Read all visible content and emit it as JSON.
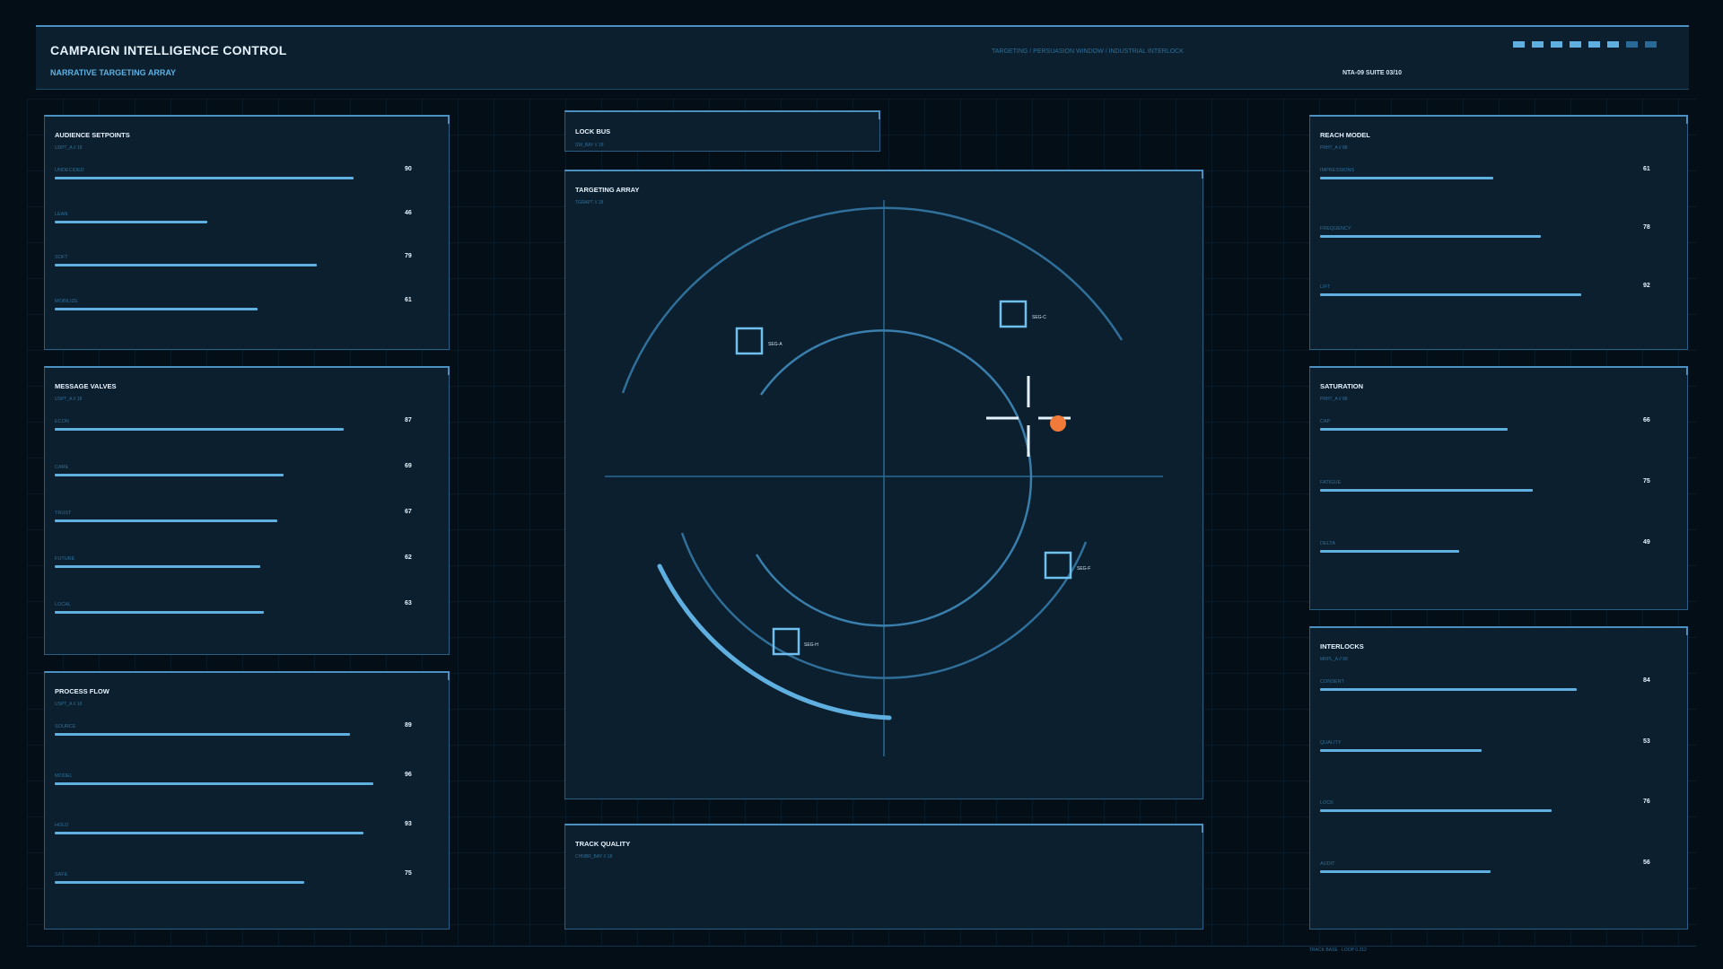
{
  "header": {
    "title": "CAMPAIGN INTELLIGENCE CONTROL",
    "subtitle": "NARRATIVE TARGETING ARRAY",
    "breadcrumb": "TARGETING / PERSUASION WINDOW / INDUSTRIAL INTERLOCK",
    "suite": "NTA-09 SUITE 03/10"
  },
  "left": {
    "audience": {
      "title": "AUDIENCE SETPOINTS",
      "code": "UDPT_A // 18",
      "metrics": [
        {
          "label": "UNDECIDED",
          "value": 90
        },
        {
          "label": "LEAN",
          "value": 46
        },
        {
          "label": "SOFT",
          "value": 79
        },
        {
          "label": "MOBILIZE",
          "value": 61
        }
      ]
    },
    "message": {
      "title": "MESSAGE VALVES",
      "code": "USPT_A // 18",
      "metrics": [
        {
          "label": "ECON",
          "value": 87
        },
        {
          "label": "CARE",
          "value": 69
        },
        {
          "label": "TRUST",
          "value": 67
        },
        {
          "label": "FUTURE",
          "value": 62
        },
        {
          "label": "LOCAL",
          "value": 63
        }
      ]
    },
    "process": {
      "title": "PROCESS FLOW",
      "code": "USPT_A // 18",
      "metrics": [
        {
          "label": "SOURCE",
          "value": 89
        },
        {
          "label": "MODEL",
          "value": 96
        },
        {
          "label": "HOLD",
          "value": 93
        },
        {
          "label": "SAFE",
          "value": 75
        }
      ]
    }
  },
  "center": {
    "lockbus": {
      "title": "LOCK BUS",
      "code": "SW_BAY // 18"
    },
    "targeting": {
      "title": "TARGETING ARRAY",
      "code": "TGRAPT // 18",
      "segments": [
        "SEG-A",
        "SEG-C",
        "SEG-F",
        "SEG-H"
      ]
    },
    "track": {
      "title": "TRACK QUALITY",
      "code": "CHNBR_BAY // 18"
    }
  },
  "right": {
    "reach": {
      "title": "REACH MODEL",
      "code": "PRHT_A // 88",
      "metrics": [
        {
          "label": "IMPRESSIONS",
          "value": 61
        },
        {
          "label": "FREQUENCY",
          "value": 78
        },
        {
          "label": "LIFT",
          "value": 92
        }
      ]
    },
    "saturation": {
      "title": "SATURATION",
      "code": "PRHT_A // 88",
      "metrics": [
        {
          "label": "CAP",
          "value": 66
        },
        {
          "label": "FATIGUE",
          "value": 75
        },
        {
          "label": "DELTA",
          "value": 49
        }
      ]
    },
    "interlocks": {
      "title": "INTERLOCKS",
      "code": "MRPL_A // 88",
      "metrics": [
        {
          "label": "CONSENT",
          "value": 84
        },
        {
          "label": "QUALITY",
          "value": 53
        },
        {
          "label": "LOCK",
          "value": 76
        },
        {
          "label": "AUDIT",
          "value": 56
        }
      ]
    }
  },
  "footer": {
    "text": "TRACK BASE · LOOP 0.212"
  },
  "colors": {
    "accent": "#5fb0e0",
    "alert": "#f07a3a",
    "panel": "#0b1f2e"
  }
}
